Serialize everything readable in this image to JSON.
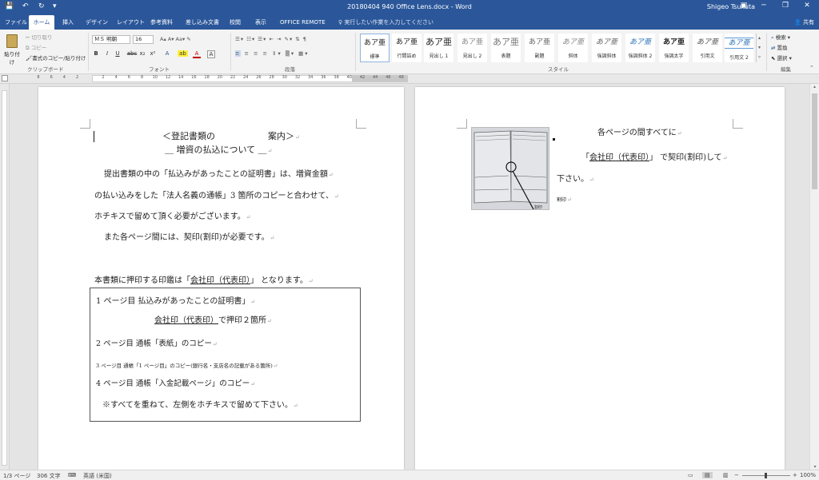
{
  "window": {
    "title": "20180404 940 Office Lens.docx - Word",
    "user": "Shigeo Tsukuta",
    "quick_access": [
      "💾",
      "↶",
      "↻",
      "▾"
    ],
    "controls": [
      "▣",
      "─",
      "❐",
      "✕"
    ]
  },
  "tabs": [
    {
      "label": "ファイル"
    },
    {
      "label": "ホーム",
      "active": true
    },
    {
      "label": "挿入"
    },
    {
      "label": "デザイン"
    },
    {
      "label": "レイアウト"
    },
    {
      "label": "参考資料"
    },
    {
      "label": "差し込み文書"
    },
    {
      "label": "校閲"
    },
    {
      "label": "表示"
    },
    {
      "label": "OFFICE REMOTE"
    }
  ],
  "tell_me": "実行したい作業を入力してください",
  "share": "共有",
  "ribbon": {
    "clipboard": {
      "label": "クリップボード",
      "paste": "貼り付け",
      "cut": "切り取り",
      "copy": "コピー",
      "format_painter": "書式のコピー/貼り付け"
    },
    "font": {
      "label": "フォント",
      "name": "ＭＳ 明朝",
      "size": "16",
      "buttons": [
        "B",
        "I",
        "U",
        "abc",
        "x₂",
        "x²",
        "A",
        "ab",
        "A",
        "A"
      ]
    },
    "paragraph": {
      "label": "段落"
    },
    "styles": {
      "label": "スタイル",
      "items": [
        {
          "sample": "あア亜",
          "name": "標準",
          "selected": true
        },
        {
          "sample": "あア亜",
          "name": "行間詰め"
        },
        {
          "sample": "あア亜",
          "name": "見出し 1"
        },
        {
          "sample": "あア亜",
          "name": "見出し 2"
        },
        {
          "sample": "あア亜",
          "name": "表題"
        },
        {
          "sample": "あア亜",
          "name": "副題"
        },
        {
          "sample": "あア亜",
          "name": "斜体"
        },
        {
          "sample": "あア亜",
          "name": "強調斜体"
        },
        {
          "sample": "あア亜",
          "name": "強調斜体 2"
        },
        {
          "sample": "あア亜",
          "name": "強調太字"
        },
        {
          "sample": "あア亜",
          "name": "引用文"
        },
        {
          "sample": "あア亜",
          "name": "引用文 2"
        }
      ]
    },
    "editing": {
      "label": "編集",
      "find": "検索",
      "replace": "置換",
      "select": "選択"
    }
  },
  "ruler_numbers": [
    "8",
    "6",
    "4",
    "2",
    "",
    "2",
    "4",
    "6",
    "8",
    "10",
    "12",
    "14",
    "16",
    "18",
    "20",
    "22",
    "24",
    "26",
    "28",
    "30",
    "32",
    "34",
    "36",
    "38",
    "40",
    "42",
    "44",
    "46",
    "48"
  ],
  "page1": {
    "title": "＜登記書類の　　　　　　案内＞",
    "subtitle": "＿ 増資の払込について ＿",
    "para1_l1": "提出書類の中の「払込みがあったことの証明書」は、増資金額",
    "para1_l2": "の払い込みをした「法人名義の通帳」3 箇所のコピーと合わせて、",
    "para1_l3": "ホチキスで留めて頂く必要がございます。",
    "para2": "また各ページ間には、契印(割印)が必要です。",
    "para3_pre": "本書類に押印する印鑑は「",
    "para3_seal": "会社印（代表印）",
    "para3_post": "」 となります。",
    "box": {
      "line1": "1 ページ目 払込みがあったことの証明書」",
      "line2_seal": "会社印（代表印）",
      "line2_post": "で押印２箇所",
      "line3": "2 ページ目 通帳「表紙」のコピー",
      "line4": "3 ページ目 通帳「1 ページ目」のコピー(銀行名・支店名の記載がある箇所)",
      "line5": "4 ページ目 通帳「入金記載ページ」のコピー",
      "line6": "※すべてを重ねて、左側をホチキスで留めて下さい。"
    }
  },
  "page2": {
    "line1": "各ページの間すべてに",
    "line2_pre": "「",
    "line2_seal": "会社印（代表印）",
    "line2_post": "」 で契印(割印)して",
    "line3": "下さい。",
    "image_label": "割印"
  },
  "status": {
    "page": "1/3 ページ",
    "words": "306 文字",
    "lang": "英語 (米国)",
    "zoom": "100%"
  }
}
